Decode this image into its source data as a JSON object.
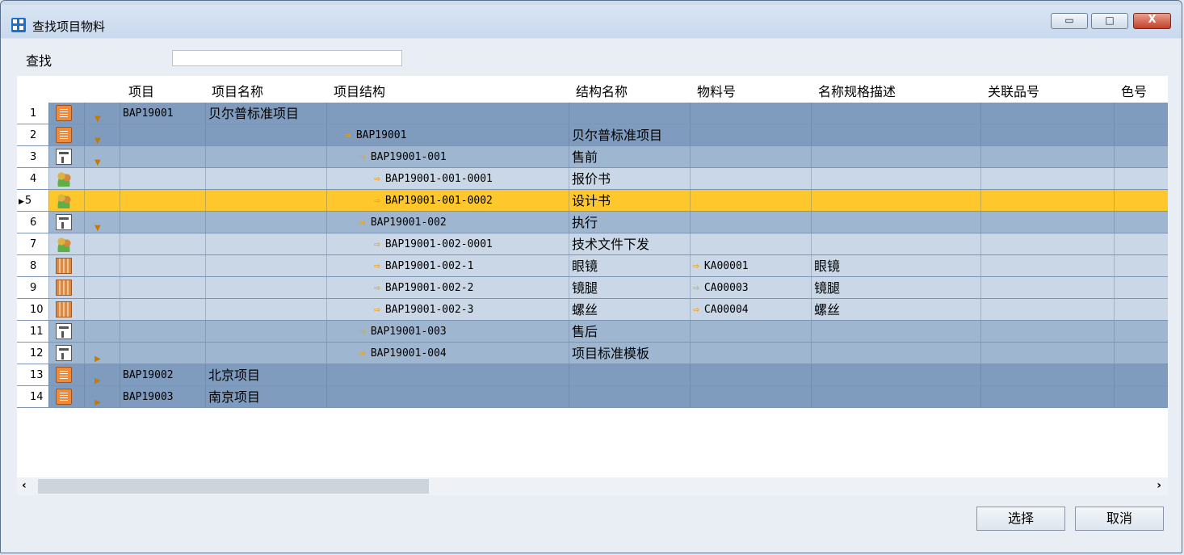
{
  "window": {
    "title": "查找项目物料",
    "minimize_glyph": "▭",
    "maximize_glyph": "□",
    "close_glyph": "X"
  },
  "search": {
    "label": "查找",
    "value": ""
  },
  "grid": {
    "columns": [
      "项目",
      "项目名称",
      "项目结构",
      "结构名称",
      "物料号",
      "名称规格描述",
      "关联品号",
      "色号"
    ],
    "rows": [
      {
        "num": "1",
        "icon": "document-icon",
        "tri": "▼",
        "project": "BAP19001",
        "project_name": "贝尔普标准项目",
        "structure": "",
        "structure_name": "",
        "material": "",
        "desc": "",
        "row_style": "dark"
      },
      {
        "num": "2",
        "icon": "document-icon",
        "tri": "▼",
        "project": "",
        "project_name": "",
        "structure": "BAP19001",
        "structure_name": "贝尔普标准项目",
        "material": "",
        "desc": "",
        "row_style": "dark"
      },
      {
        "num": "3",
        "icon": "tree-icon",
        "tri": "▼",
        "project": "",
        "project_name": "",
        "structure": "BAP19001-001",
        "structure_name": "售前",
        "material": "",
        "desc": "",
        "row_style": "mid"
      },
      {
        "num": "4",
        "icon": "users-icon",
        "tri": "",
        "project": "",
        "project_name": "",
        "structure": "BAP19001-001-0001",
        "structure_name": "报价书",
        "material": "",
        "desc": "",
        "row_style": "light"
      },
      {
        "num": "5",
        "icon": "users-icon",
        "tri": "",
        "project": "",
        "project_name": "",
        "structure": "BAP19001-001-0002",
        "structure_name": "设计书",
        "material": "",
        "desc": "",
        "row_style": "selected"
      },
      {
        "num": "6",
        "icon": "tree-icon",
        "tri": "▼",
        "project": "",
        "project_name": "",
        "structure": "BAP19001-002",
        "structure_name": "执行",
        "material": "",
        "desc": "",
        "row_style": "mid"
      },
      {
        "num": "7",
        "icon": "users-icon",
        "tri": "",
        "project": "",
        "project_name": "",
        "structure": "BAP19001-002-0001",
        "structure_name": "技术文件下发",
        "material": "",
        "desc": "",
        "row_style": "light"
      },
      {
        "num": "8",
        "icon": "box-icon",
        "tri": "",
        "project": "",
        "project_name": "",
        "structure": "BAP19001-002-1",
        "structure_name": "眼镜",
        "material": "KA00001",
        "desc": "眼镜",
        "row_style": "light"
      },
      {
        "num": "9",
        "icon": "box-icon",
        "tri": "",
        "project": "",
        "project_name": "",
        "structure": "BAP19001-002-2",
        "structure_name": "镜腿",
        "material": "CA00003",
        "desc": "镜腿",
        "row_style": "light"
      },
      {
        "num": "10",
        "icon": "box-icon",
        "tri": "",
        "project": "",
        "project_name": "",
        "structure": "BAP19001-002-3",
        "structure_name": "螺丝",
        "material": "CA00004",
        "desc": "螺丝",
        "row_style": "light"
      },
      {
        "num": "11",
        "icon": "tree-icon",
        "tri": "",
        "project": "",
        "project_name": "",
        "structure": "BAP19001-003",
        "structure_name": "售后",
        "material": "",
        "desc": "",
        "row_style": "mid"
      },
      {
        "num": "12",
        "icon": "tree-icon",
        "tri": "▶",
        "project": "",
        "project_name": "",
        "structure": "BAP19001-004",
        "structure_name": "项目标准模板",
        "material": "",
        "desc": "",
        "row_style": "mid"
      },
      {
        "num": "13",
        "icon": "document-icon",
        "tri": "▶",
        "project": "BAP19002",
        "project_name": "北京项目",
        "structure": "",
        "structure_name": "",
        "material": "",
        "desc": "",
        "row_style": "dark"
      },
      {
        "num": "14",
        "icon": "document-icon",
        "tri": "▶",
        "project": "BAP19003",
        "project_name": "南京项目",
        "structure": "",
        "structure_name": "",
        "material": "",
        "desc": "",
        "row_style": "dark"
      }
    ]
  },
  "buttons": {
    "select": "选择",
    "cancel": "取消"
  },
  "colors": {
    "dark_row": "#7f9bbd",
    "mid_row": "#9fb6d1",
    "light_row": "#c9d7e6",
    "selected_row": "#fec82c",
    "arrow": "#f0a010"
  }
}
